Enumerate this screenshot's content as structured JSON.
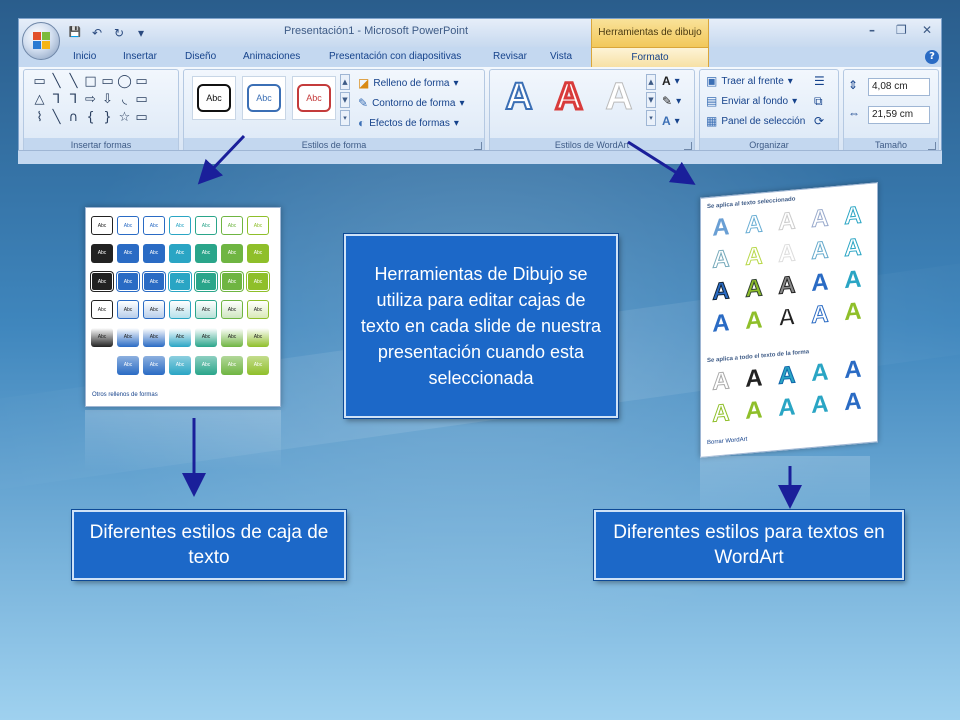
{
  "window": {
    "title": "Presentación1 - Microsoft PowerPoint",
    "context_title": "Herramientas de dibujo",
    "controls": [
      "–",
      "❐",
      "✕"
    ]
  },
  "qat": {
    "save": "💾",
    "undo": "↶",
    "redo": "↻",
    "more": "▾"
  },
  "tabs": [
    "Inicio",
    "Insertar",
    "Diseño",
    "Animaciones",
    "Presentación con diapositivas",
    "Revisar",
    "Vista"
  ],
  "active_tab": "Formato",
  "help": "?",
  "groups": {
    "insertar_formas": {
      "label": "Insertar formas",
      "shapes": [
        "▭",
        "╲",
        "╲",
        "□",
        "▭",
        "◯",
        "▭",
        "△",
        "⅂",
        "⅂",
        "⇨",
        "⇩",
        "◟",
        "▭",
        "⌇",
        "╲",
        "∩",
        "{",
        "}",
        "☆",
        "▭"
      ]
    },
    "estilos_forma": {
      "label": "Estilos de forma",
      "abc": "Abc",
      "commands": [
        "Relleno de forma",
        "Contorno de forma",
        "Efectos de formas"
      ]
    },
    "wordart": {
      "label": "Estilos de WordArt",
      "letter": "A"
    },
    "organizar": {
      "label": "Organizar",
      "commands": [
        "Traer al frente",
        "Enviar al fondo",
        "Panel de selección"
      ]
    },
    "tamano": {
      "label": "Tamaño",
      "height": "4,08 cm",
      "width": "21,59 cm"
    }
  },
  "gallery_shapes": {
    "cell": "Abc",
    "footer": "Otros rellenos de formas"
  },
  "gallery_wordart": {
    "header1": "Se aplica al texto seleccionado",
    "header2": "Se aplica a todo el texto de la forma",
    "letter": "A",
    "footer": "Borrar WordArt"
  },
  "callouts": {
    "center": "Herramientas de Dibujo se utiliza para editar cajas de texto en cada slide de nuestra presentación cuando esta seleccionada",
    "left": "Diferentes estilos de caja de texto",
    "right": "Diferentes estilos para textos en WordArt"
  },
  "colors": {
    "callout": "#1c68c8",
    "arrow": "#1a1f9a",
    "context_tab": "#f2c85a"
  }
}
